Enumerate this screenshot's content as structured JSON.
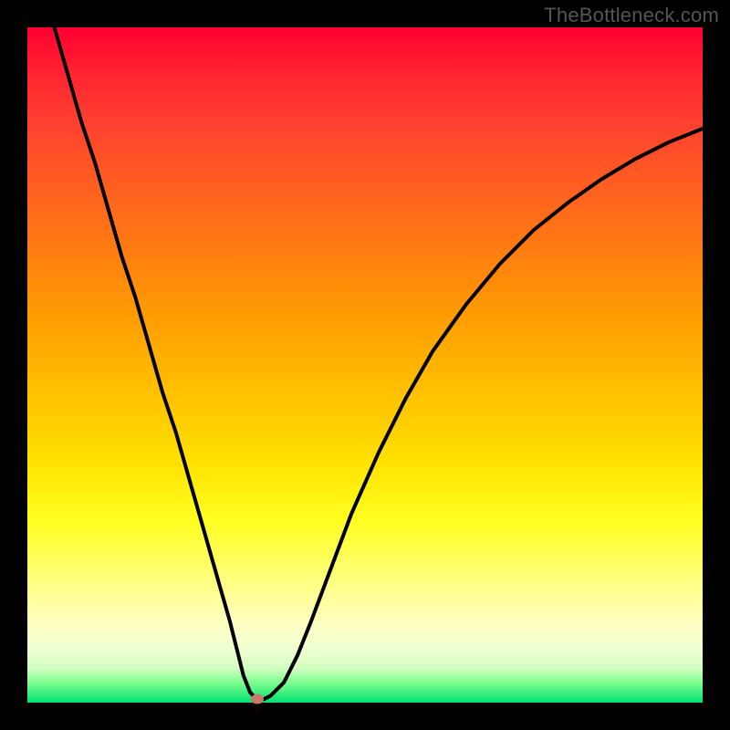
{
  "watermark": "TheBottleneck.com",
  "chart_data": {
    "type": "line",
    "title": "",
    "xlabel": "",
    "ylabel": "",
    "xlim": [
      0,
      100
    ],
    "ylim": [
      0,
      100
    ],
    "series": [
      {
        "name": "bottleneck-curve",
        "x": [
          4,
          6,
          8,
          10,
          12,
          14,
          16,
          18,
          20,
          22,
          24,
          26,
          28,
          30,
          31,
          32,
          33,
          34,
          35,
          36,
          38,
          40,
          42,
          45,
          48,
          52,
          56,
          60,
          65,
          70,
          75,
          80,
          85,
          90,
          95,
          100
        ],
        "y": [
          100,
          93,
          86,
          80,
          73,
          66,
          60,
          53,
          46,
          40,
          33,
          26,
          19,
          12,
          8,
          4,
          1.5,
          0.5,
          0.5,
          1,
          3,
          7,
          12,
          20,
          28,
          37,
          45,
          52,
          59,
          65,
          70,
          74,
          77.5,
          80.5,
          83,
          85
        ]
      }
    ],
    "marker": {
      "x": 34,
      "y": 0.5
    },
    "background_gradient": {
      "top": "#ff0030",
      "middle": "#ffe000",
      "bottom": "#00e070"
    }
  }
}
